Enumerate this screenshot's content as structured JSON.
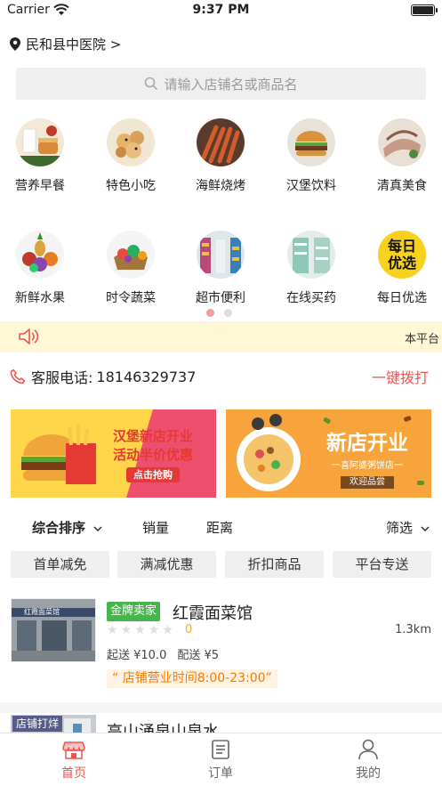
{
  "status_bar": {
    "carrier": "Carrier",
    "time": "9:37 PM"
  },
  "location": {
    "label": "民和县中医院 >"
  },
  "search": {
    "placeholder": "请输入店铺名或商品名"
  },
  "categories": [
    {
      "label": "营养早餐",
      "icon": "breakfast-icon"
    },
    {
      "label": "特色小吃",
      "icon": "snack-icon"
    },
    {
      "label": "海鲜烧烤",
      "icon": "bbq-icon"
    },
    {
      "label": "汉堡饮料",
      "icon": "burger-icon"
    },
    {
      "label": "清真美食",
      "icon": "halal-icon"
    },
    {
      "label": "新鲜水果",
      "icon": "fruit-icon"
    },
    {
      "label": "时令蔬菜",
      "icon": "vegetable-icon"
    },
    {
      "label": "超市便利",
      "icon": "supermarket-icon"
    },
    {
      "label": "在线买药",
      "icon": "pharmacy-icon"
    },
    {
      "label": "每日优选",
      "icon": "daily-select-icon"
    }
  ],
  "daily_select_logo": {
    "line1": "每日",
    "line2": "优选"
  },
  "notice": {
    "text": "本平台"
  },
  "service": {
    "label": "客服电话:",
    "phone": "18146329737",
    "call_label": "一键拨打"
  },
  "banners": [
    {
      "title": "汉堡新店开业",
      "subtitle": "活动半价优惠",
      "cta": "点击抢购"
    },
    {
      "title": "新店开业",
      "subtitle": "一喜阿婆粥饼店一",
      "cta": "欢迎品尝"
    }
  ],
  "sort": {
    "comprehensive": "综合排序",
    "sales": "销量",
    "distance": "距离",
    "filter": "筛选"
  },
  "chips": [
    "首单减免",
    "满减优惠",
    "折扣商品",
    "平台专送"
  ],
  "shops": [
    {
      "badge": "金牌卖家",
      "name": "红霞面菜馆",
      "rating": "0",
      "distance": "1.3km",
      "min_order": "起送 ¥10.0",
      "delivery_fee": "配送 ¥5",
      "hours": "“ 店铺营业时间8:00-23:00”",
      "sign_text": "红霞面菜馆"
    },
    {
      "badge": "店铺打烊",
      "name": "高山涌泉山泉水"
    }
  ],
  "tabbar": [
    {
      "label": "首页",
      "icon": "home-icon",
      "active": true
    },
    {
      "label": "订单",
      "icon": "order-icon",
      "active": false
    },
    {
      "label": "我的",
      "icon": "profile-icon",
      "active": false
    }
  ],
  "colors": {
    "accent": "#ef5350",
    "notice_bg": "#fff7d6",
    "gold_badge": "#45b649",
    "hours_text": "#f57c00"
  }
}
